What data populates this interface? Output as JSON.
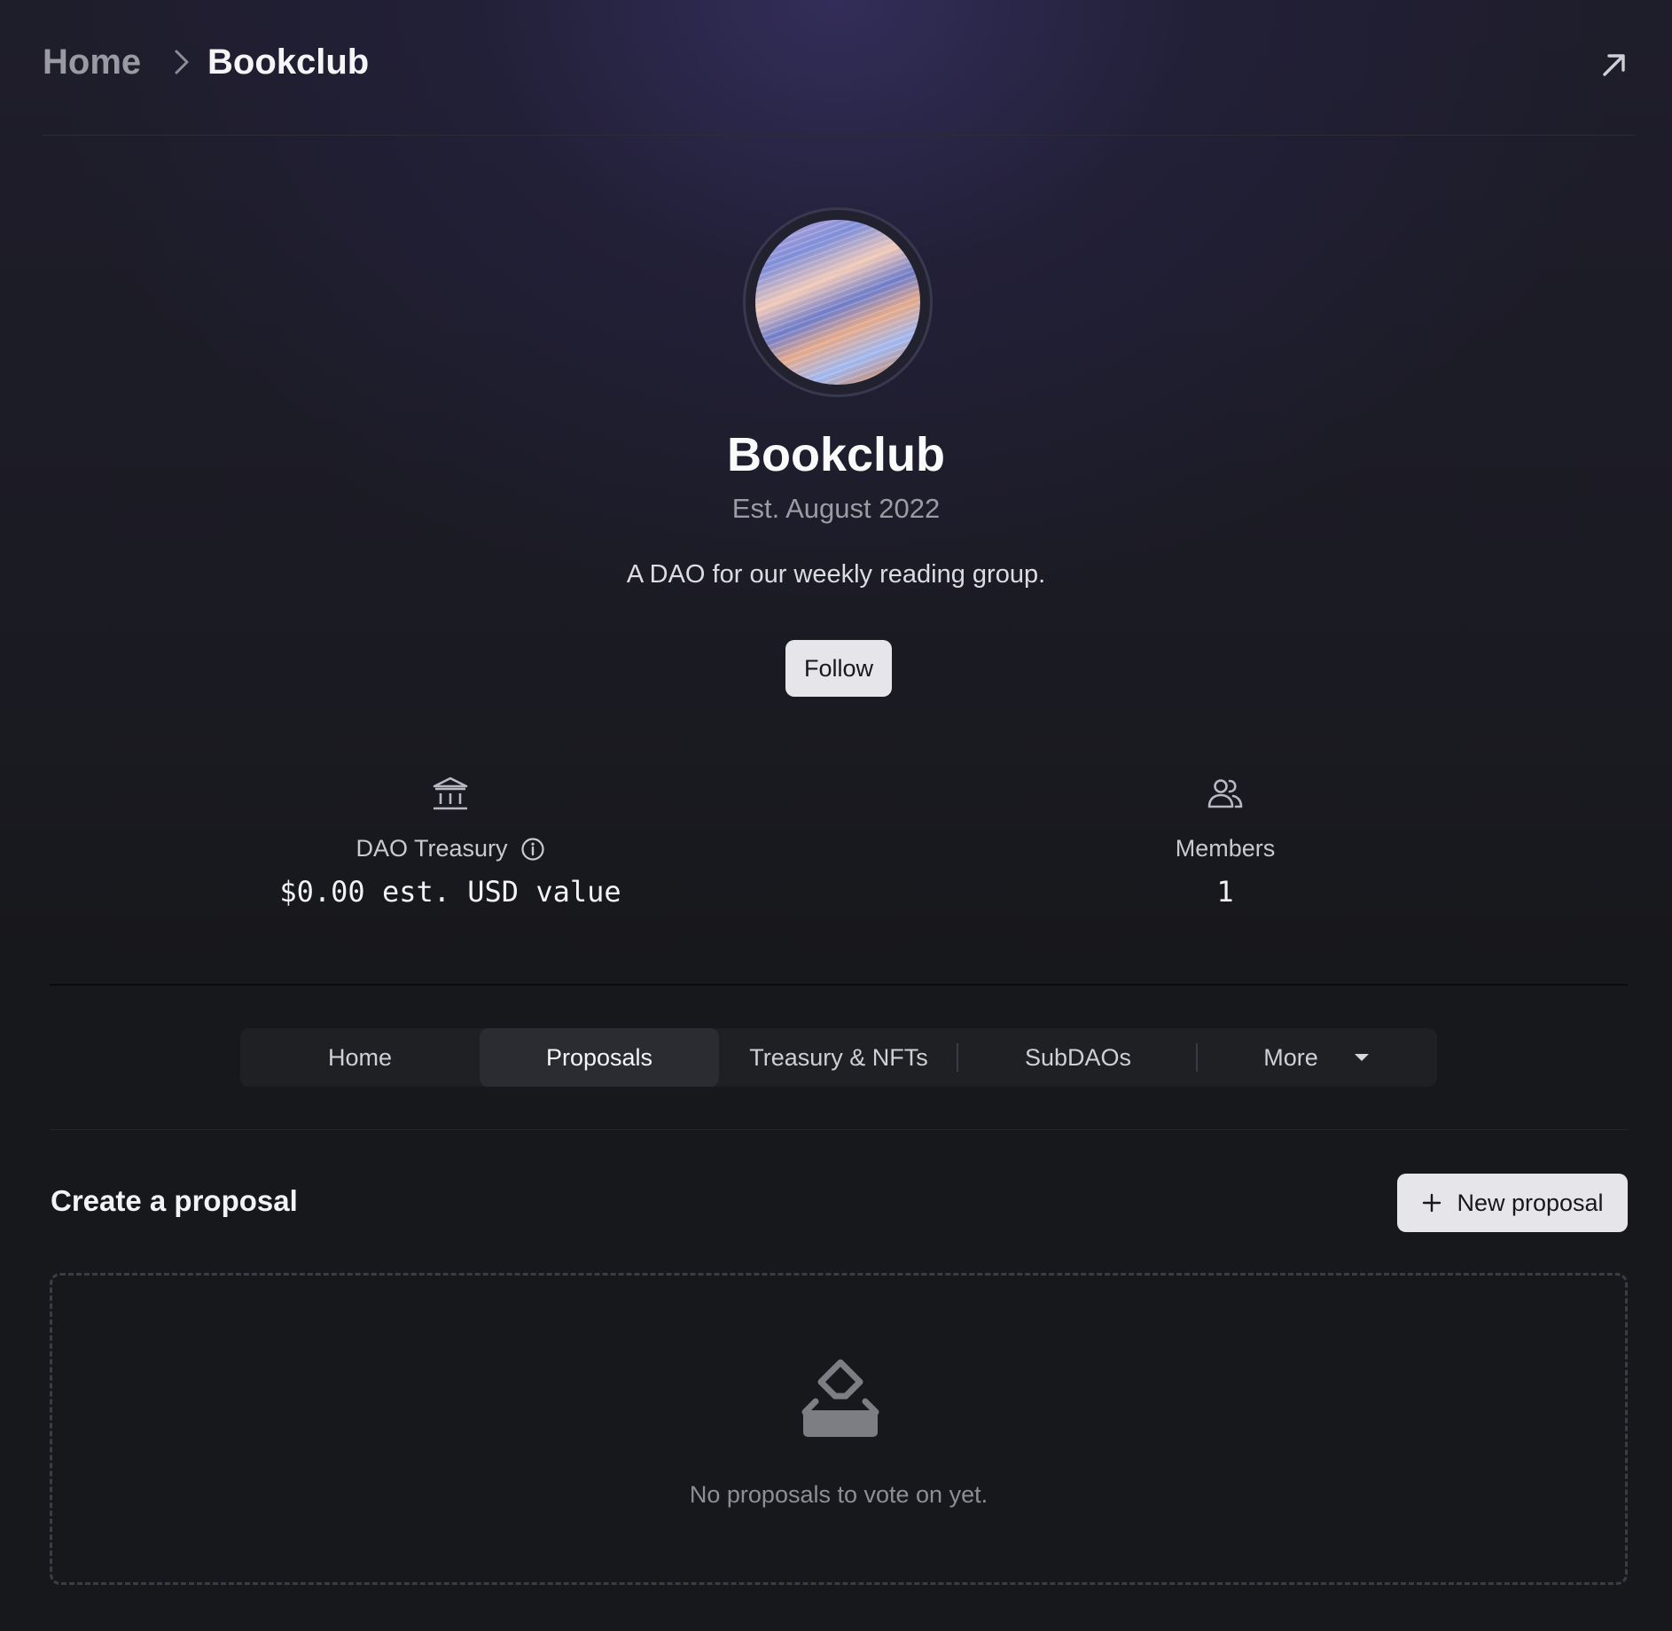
{
  "breadcrumb": {
    "home_label": "Home",
    "current_label": "Bookclub",
    "share_icon": "arrow-up-right-icon"
  },
  "profile": {
    "name": "Bookclub",
    "established": "Est. August 2022",
    "description": "A DAO for our weekly reading group.",
    "follow_label": "Follow"
  },
  "stats": {
    "treasury": {
      "icon": "bank-icon",
      "label": "DAO Treasury",
      "value": "$0.00 est. USD value"
    },
    "members": {
      "icon": "users-icon",
      "label": "Members",
      "value": "1"
    }
  },
  "tabs": [
    {
      "label": "Home",
      "active": false
    },
    {
      "label": "Proposals",
      "active": true
    },
    {
      "label": "Treasury & NFTs",
      "active": false
    },
    {
      "label": "SubDAOs",
      "active": false
    },
    {
      "label": "More",
      "active": false
    }
  ],
  "proposals": {
    "section_title": "Create a proposal",
    "new_button_label": "New proposal",
    "empty_icon": "ballot-box-icon",
    "empty_text": "No proposals to vote on yet."
  },
  "colors": {
    "background": "#17181b",
    "hero_glow": "#2f2b55",
    "button_bg": "#e6e6ea",
    "text_primary": "#f3f3f5",
    "text_muted": "#9b9ba4"
  }
}
